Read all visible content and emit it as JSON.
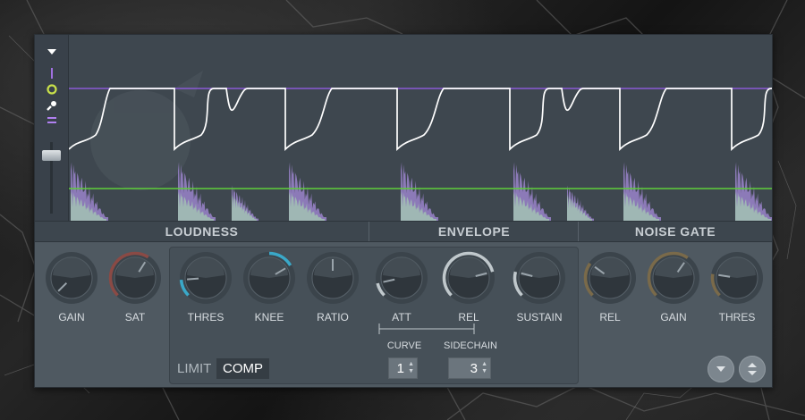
{
  "sections": {
    "loudness": "LOUDNESS",
    "envelope": "ENVELOPE",
    "noise_gate": "NOISE GATE"
  },
  "knobs": {
    "gain": {
      "label": "GAIN",
      "value": 0.0,
      "arc_color": "#7a55c8"
    },
    "sat": {
      "label": "SAT",
      "value": 0.62,
      "arc_color": "#8a4a45"
    },
    "thres": {
      "label": "THRES",
      "value": 0.15,
      "arc_color": "#3aa8c8"
    },
    "knee": {
      "label": "KNEE",
      "value": 0.72,
      "arc_color": "#3aa8c8"
    },
    "ratio": {
      "label": "RATIO",
      "value": 0.5,
      "arc_color": "#3aa8c8"
    },
    "att": {
      "label": "ATT",
      "value": 0.12,
      "arc_color": "#c0c8cc"
    },
    "rel": {
      "label": "REL",
      "value": 0.78,
      "arc_color": "#c0c8cc"
    },
    "sustain": {
      "label": "SUSTAIN",
      "value": 0.22,
      "arc_color": "#c0c8cc"
    },
    "gate_rel": {
      "label": "REL",
      "value": 0.3,
      "arc_color": "#7a6a4a"
    },
    "gate_gain": {
      "label": "GAIN",
      "value": 0.63,
      "arc_color": "#7a6a4a"
    },
    "gate_thres": {
      "label": "THRES",
      "value": 0.2,
      "arc_color": "#7a6a4a"
    }
  },
  "spinners": {
    "curve": {
      "label": "CURVE",
      "value": "1"
    },
    "sidechain": {
      "label": "SIDECHAIN",
      "value": "3"
    }
  },
  "modes": {
    "limit": "LIMIT",
    "comp": "COMP",
    "active": "comp"
  },
  "tools": [
    "menu-arrow-icon",
    "line-tool-icon",
    "point-tool-icon",
    "brush-tool-icon",
    "equals-tool-icon"
  ],
  "colors": {
    "threshold_line": "#8a5ad6",
    "gate_line": "#5fcf3a",
    "envelope_line": "#ffffff",
    "waveform_upper": "#8c7ab8",
    "waveform_lower": "#9fb7b4",
    "display_bg": "#3e474f"
  }
}
